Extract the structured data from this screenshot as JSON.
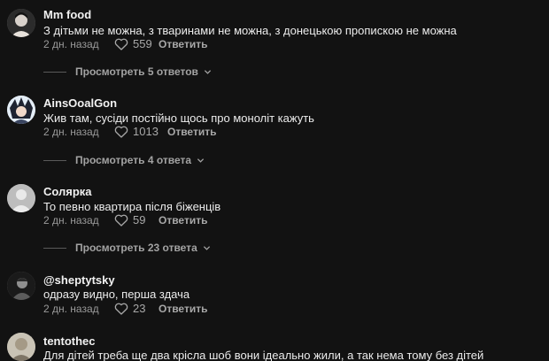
{
  "comments": [
    {
      "username": "Mm food",
      "text": "З дітьми не можна, з тваринами не можна, з донецькою пропискою не можна",
      "date": "2 дн. назад",
      "likes": "559",
      "reply_label": "Ответить",
      "replies_label": "Просмотреть 5 ответов"
    },
    {
      "username": "AinsOoalGon",
      "text": "Жив там, сусіди постійно щось про моноліт кажуть",
      "date": "2 дн. назад",
      "likes": "1013",
      "reply_label": "Ответить",
      "replies_label": "Просмотреть 4 ответа"
    },
    {
      "username": "Солярка",
      "text": "То певно квартира після біженців",
      "date": "2 дн. назад",
      "likes": "59",
      "reply_label": "Ответить",
      "replies_label": "Просмотреть 23 ответа"
    },
    {
      "username": "@sheptytsky",
      "text": "одразу видно, перша здача",
      "date": "2 дн. назад",
      "likes": "23",
      "reply_label": "Ответить"
    },
    {
      "username": "tentothec",
      "text": "Для дітей треба ще два крісла шоб вони ідеально жили, а так нема тому без дітей"
    }
  ],
  "icons": {
    "like": "heart-outline-icon",
    "expand": "chevron-down-icon"
  },
  "colors": {
    "background": "#121212",
    "text": "#ececec",
    "muted": "#9a9a9a"
  }
}
